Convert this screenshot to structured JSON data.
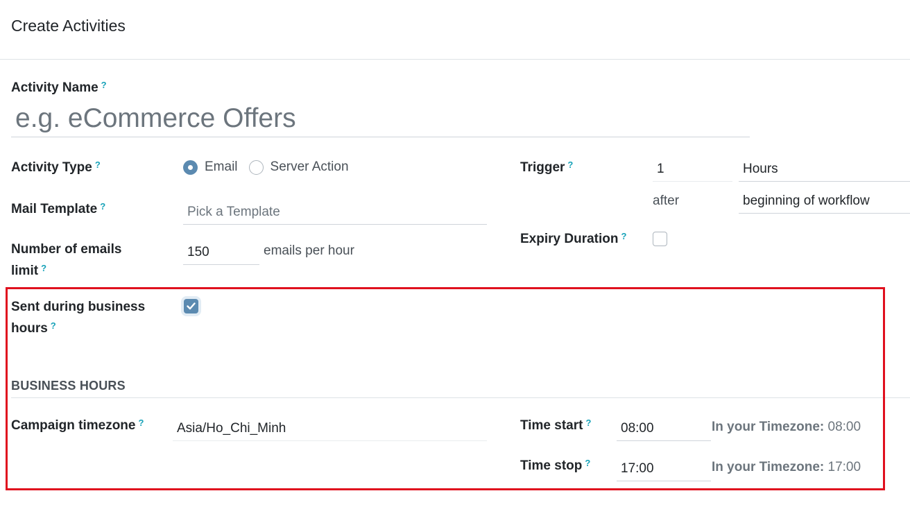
{
  "header": {
    "title": "Create Activities"
  },
  "help_mark": "?",
  "activity_name": {
    "label": "Activity Name",
    "placeholder": "e.g. eCommerce Offers",
    "value": ""
  },
  "activity_type": {
    "label": "Activity Type",
    "options": [
      {
        "label": "Email",
        "checked": true
      },
      {
        "label": "Server Action",
        "checked": false
      }
    ]
  },
  "mail_template": {
    "label": "Mail Template",
    "placeholder": "Pick a Template",
    "value": ""
  },
  "emails_limit": {
    "label_line1": "Number of emails",
    "label_line2": "limit",
    "value": "150",
    "suffix": "emails per hour"
  },
  "trigger": {
    "label": "Trigger",
    "interval": "1",
    "unit": "Hours",
    "after_label": "after",
    "type": "beginning of workflow"
  },
  "expiry_duration": {
    "label": "Expiry Duration",
    "checked": false
  },
  "business_hours_toggle": {
    "label_line1": "Sent during business",
    "label_line2": "hours",
    "checked": true
  },
  "business_hours": {
    "section_title": "BUSINESS HOURS",
    "timezone": {
      "label": "Campaign timezone",
      "value": "Asia/Ho_Chi_Minh"
    },
    "time_start": {
      "label": "Time start",
      "value": "08:00",
      "tz_label": "In your Timezone:",
      "tz_value": "08:00"
    },
    "time_stop": {
      "label": "Time stop",
      "value": "17:00",
      "tz_label": "In your Timezone:",
      "tz_value": "17:00"
    }
  },
  "colors": {
    "accent": "#5b8ab0",
    "help": "#17a2b8",
    "highlight": "#e0101e"
  }
}
